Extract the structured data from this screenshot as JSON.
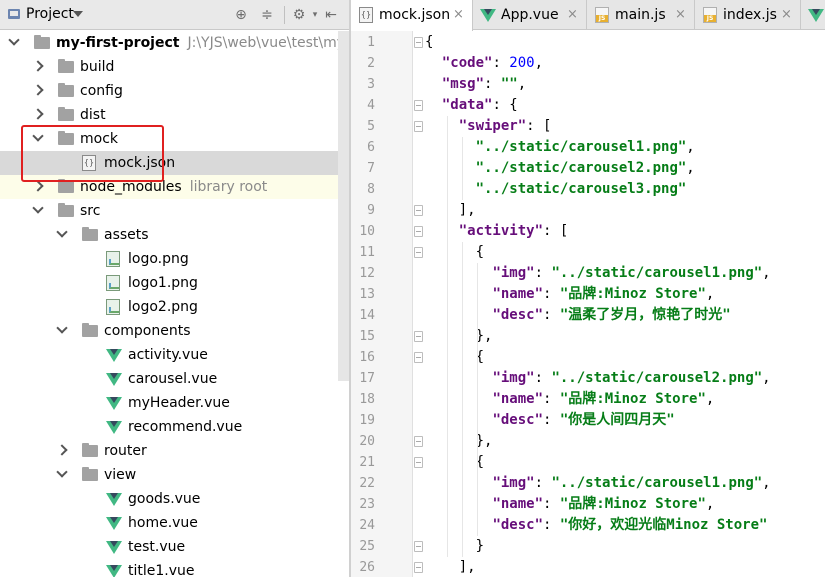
{
  "project_panel": {
    "title": "Project",
    "toolbar_icons": [
      "target-icon",
      "collapse-icon",
      "gear-icon",
      "hide-icon"
    ],
    "tree": [
      {
        "label": "my-first-project",
        "hint": "J:\\YJS\\web\\vue\\test\\my-first-p",
        "type": "folder",
        "depth": 0,
        "expanded": true,
        "bold": true
      },
      {
        "label": "build",
        "type": "folder",
        "depth": 1,
        "expanded": false
      },
      {
        "label": "config",
        "type": "folder",
        "depth": 1,
        "expanded": false
      },
      {
        "label": "dist",
        "type": "folder",
        "depth": 1,
        "expanded": false
      },
      {
        "label": "mock",
        "type": "folder",
        "depth": 1,
        "expanded": true
      },
      {
        "label": "mock.json",
        "type": "json",
        "depth": 2,
        "selected": true
      },
      {
        "label": "node_modules",
        "hint": "library root",
        "type": "folder",
        "depth": 1,
        "expanded": false,
        "excluded": true
      },
      {
        "label": "src",
        "type": "folder",
        "depth": 1,
        "expanded": true
      },
      {
        "label": "assets",
        "type": "folder",
        "depth": 2,
        "expanded": true
      },
      {
        "label": "logo.png",
        "type": "image",
        "depth": 3
      },
      {
        "label": "logo1.png",
        "type": "image",
        "depth": 3
      },
      {
        "label": "logo2.png",
        "type": "image",
        "depth": 3
      },
      {
        "label": "components",
        "type": "folder",
        "depth": 2,
        "expanded": true
      },
      {
        "label": "activity.vue",
        "type": "vue",
        "depth": 3
      },
      {
        "label": "carousel.vue",
        "type": "vue",
        "depth": 3
      },
      {
        "label": "myHeader.vue",
        "type": "vue",
        "depth": 3
      },
      {
        "label": "recommend.vue",
        "type": "vue",
        "depth": 3
      },
      {
        "label": "router",
        "type": "folder",
        "depth": 2,
        "expanded": false
      },
      {
        "label": "view",
        "type": "folder",
        "depth": 2,
        "expanded": true
      },
      {
        "label": "goods.vue",
        "type": "vue",
        "depth": 3
      },
      {
        "label": "home.vue",
        "type": "vue",
        "depth": 3
      },
      {
        "label": "test.vue",
        "type": "vue",
        "depth": 3
      },
      {
        "label": "title1.vue",
        "type": "vue",
        "depth": 3
      }
    ]
  },
  "tabs": [
    {
      "label": "mock.json",
      "type": "json",
      "active": true
    },
    {
      "label": "App.vue",
      "type": "vue"
    },
    {
      "label": "main.js",
      "type": "js"
    },
    {
      "label": "index.js",
      "type": "js"
    },
    {
      "label": "",
      "type": "vue"
    }
  ],
  "tab_close_glyph": "×",
  "code_lines": [
    [
      [
        "p",
        "{"
      ]
    ],
    [
      [
        "p",
        "  "
      ],
      [
        "k",
        "\"code\""
      ],
      [
        "p",
        ": "
      ],
      [
        "n",
        "200"
      ],
      [
        "p",
        ","
      ]
    ],
    [
      [
        "p",
        "  "
      ],
      [
        "k",
        "\"msg\""
      ],
      [
        "p",
        ": "
      ],
      [
        "s",
        "\"\""
      ],
      [
        "p",
        ","
      ]
    ],
    [
      [
        "p",
        "  "
      ],
      [
        "k",
        "\"data\""
      ],
      [
        "p",
        ": {"
      ]
    ],
    [
      [
        "p",
        "    "
      ],
      [
        "k",
        "\"swiper\""
      ],
      [
        "p",
        ": ["
      ]
    ],
    [
      [
        "p",
        "      "
      ],
      [
        "s",
        "\"../static/carousel1.png\""
      ],
      [
        "p",
        ","
      ]
    ],
    [
      [
        "p",
        "      "
      ],
      [
        "s",
        "\"../static/carousel2.png\""
      ],
      [
        "p",
        ","
      ]
    ],
    [
      [
        "p",
        "      "
      ],
      [
        "s",
        "\"../static/carousel3.png\""
      ]
    ],
    [
      [
        "p",
        "    ],"
      ]
    ],
    [
      [
        "p",
        "    "
      ],
      [
        "k",
        "\"activity\""
      ],
      [
        "p",
        ": ["
      ]
    ],
    [
      [
        "p",
        "      {"
      ]
    ],
    [
      [
        "p",
        "        "
      ],
      [
        "k",
        "\"img\""
      ],
      [
        "p",
        ": "
      ],
      [
        "s",
        "\"../static/carousel1.png\""
      ],
      [
        "p",
        ","
      ]
    ],
    [
      [
        "p",
        "        "
      ],
      [
        "k",
        "\"name\""
      ],
      [
        "p",
        ": "
      ],
      [
        "s",
        "\"品牌:Minoz Store\""
      ],
      [
        "p",
        ","
      ]
    ],
    [
      [
        "p",
        "        "
      ],
      [
        "k",
        "\"desc\""
      ],
      [
        "p",
        ": "
      ],
      [
        "s",
        "\"温柔了岁月，惊艳了时光\""
      ]
    ],
    [
      [
        "p",
        "      },"
      ]
    ],
    [
      [
        "p",
        "      {"
      ]
    ],
    [
      [
        "p",
        "        "
      ],
      [
        "k",
        "\"img\""
      ],
      [
        "p",
        ": "
      ],
      [
        "s",
        "\"../static/carousel2.png\""
      ],
      [
        "p",
        ","
      ]
    ],
    [
      [
        "p",
        "        "
      ],
      [
        "k",
        "\"name\""
      ],
      [
        "p",
        ": "
      ],
      [
        "s",
        "\"品牌:Minoz Store\""
      ],
      [
        "p",
        ","
      ]
    ],
    [
      [
        "p",
        "        "
      ],
      [
        "k",
        "\"desc\""
      ],
      [
        "p",
        ": "
      ],
      [
        "s",
        "\"你是人间四月天\""
      ]
    ],
    [
      [
        "p",
        "      },"
      ]
    ],
    [
      [
        "p",
        "      {"
      ]
    ],
    [
      [
        "p",
        "        "
      ],
      [
        "k",
        "\"img\""
      ],
      [
        "p",
        ": "
      ],
      [
        "s",
        "\"../static/carousel1.png\""
      ],
      [
        "p",
        ","
      ]
    ],
    [
      [
        "p",
        "        "
      ],
      [
        "k",
        "\"name\""
      ],
      [
        "p",
        ": "
      ],
      [
        "s",
        "\"品牌:Minoz Store\""
      ],
      [
        "p",
        ","
      ]
    ],
    [
      [
        "p",
        "        "
      ],
      [
        "k",
        "\"desc\""
      ],
      [
        "p",
        ": "
      ],
      [
        "s",
        "\"你好，欢迎光临Minoz Store\""
      ]
    ],
    [
      [
        "p",
        "      }"
      ]
    ],
    [
      [
        "p",
        "    ],"
      ]
    ]
  ],
  "fold_lines": [
    1,
    4,
    5,
    9,
    10,
    11,
    15,
    16,
    20,
    21,
    25,
    26
  ],
  "colors": {
    "keyword": "#660e7a",
    "string": "#067d17",
    "number": "#0000ff",
    "highlight": "#e02020",
    "vue": "#41b883"
  }
}
